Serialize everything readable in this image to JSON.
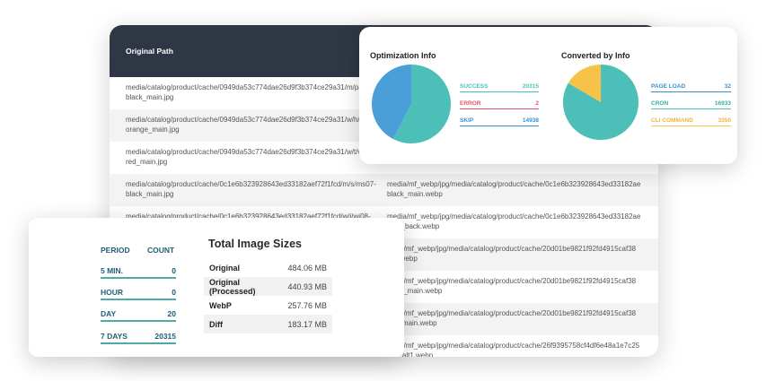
{
  "table": {
    "header": "Original Path",
    "rows": [
      {
        "original": "media/catalog/product/cache/0949da53c774dae26d9f3b374ce29a31/m/pa black_main.jpg",
        "converted": ""
      },
      {
        "original": "media/catalog/product/cache/0949da53c774dae26d9f3b374ce29a31/w/h/ orange_main.jpg",
        "converted": ""
      },
      {
        "original": "media/catalog/product/cache/0949da53c774dae26d9f3b374ce29a31/w/t/v red_main.jpg",
        "converted": ""
      },
      {
        "original": "media/catalog/product/cache/0c1e6b323928643ed33182aef72f1fcd/m/s/ms07-black_main.jpg",
        "converted": "media/mf_webp/jpg/media/catalog/product/cache/0c1e6b323928643ed33182ae black_main.webp"
      },
      {
        "original": "media/catalog/product/cache/0c1e6b323928643ed33182aef72f1fcd/w/j/wj08-gray_back.jpg",
        "converted": "media/mf_webp/jpg/media/catalog/product/cache/0c1e6b323928643ed33182ae gray_back.webp"
      },
      {
        "original": "",
        "converted": "dia/mf_webp/jpg/media/catalog/product/cache/20d01be9821f92fd4915caf38 b.webp"
      },
      {
        "original": "",
        "converted": "dia/mf_webp/jpg/media/catalog/product/cache/20d01be9821f92fd4915caf38 ow_main.webp"
      },
      {
        "original": "",
        "converted": "dia/mf_webp/jpg/media/catalog/product/cache/20d01be9821f92fd4915caf38 e_main.webp"
      },
      {
        "original": "",
        "converted": "dia/mf_webp/jpg/media/catalog/product/cache/26f9395758cf4df6e48a1e7c25 e_alt1.webp"
      }
    ]
  },
  "optimization": {
    "title": "Optimization Info",
    "items": [
      {
        "label": "SUCCESS",
        "value": "20315",
        "color": "#4cbfb9"
      },
      {
        "label": "ERROR",
        "value": "2",
        "color": "#e8536a"
      },
      {
        "label": "SKIP",
        "value": "14938",
        "color": "#4a9fd8"
      }
    ],
    "pie": [
      {
        "value": 20315,
        "color": "#4cbfb9"
      },
      {
        "value": 2,
        "color": "#e8536a"
      },
      {
        "value": 14938,
        "color": "#4a9fd8"
      }
    ]
  },
  "converted": {
    "title": "Converted by Info",
    "items": [
      {
        "label": "PAGE LOAD",
        "value": "32",
        "color": "#3a8fd1"
      },
      {
        "label": "CRON",
        "value": "16933",
        "color": "#4cbfb9"
      },
      {
        "label": "CLI COMMAND",
        "value": "3350",
        "color": "#f7c24a"
      }
    ],
    "pie": [
      {
        "value": 32,
        "color": "#3a8fd1"
      },
      {
        "value": 16933,
        "color": "#4cbfb9"
      },
      {
        "value": 3350,
        "color": "#f7c24a"
      }
    ]
  },
  "stats": {
    "period_header": "PERIOD",
    "count_header": "COUNT",
    "periods": [
      {
        "label": "5 MIN.",
        "count": "0"
      },
      {
        "label": "HOUR",
        "count": "0"
      },
      {
        "label": "DAY",
        "count": "20"
      },
      {
        "label": "7 DAYS",
        "count": "20315"
      }
    ],
    "sizes_title": "Total Image Sizes",
    "sizes": [
      {
        "label": "Original",
        "value": "484.06 MB"
      },
      {
        "label": "Original (Processed)",
        "value": "440.93 MB"
      },
      {
        "label": "WebP",
        "value": "257.76 MB"
      },
      {
        "label": "Diff",
        "value": "183.17 MB"
      }
    ]
  }
}
